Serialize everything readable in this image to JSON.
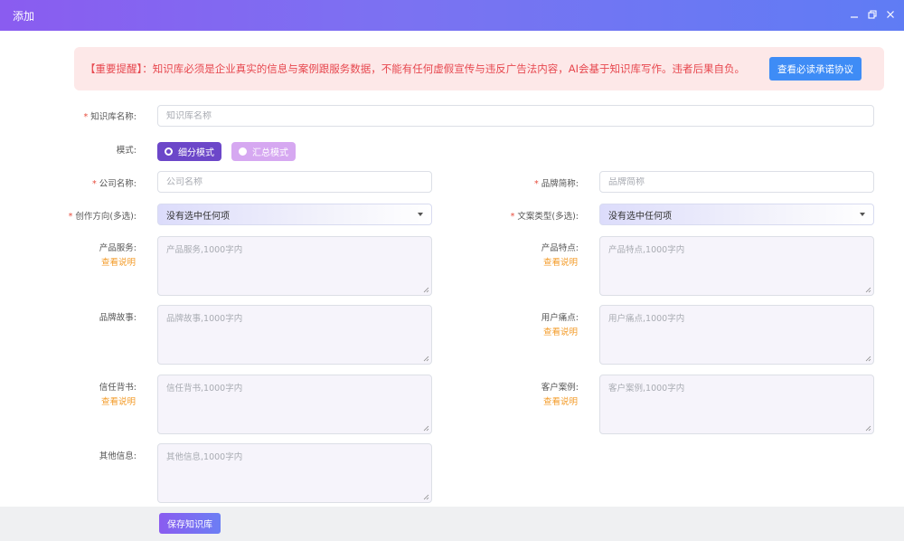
{
  "window": {
    "title": "添加",
    "controls": [
      "minimize-icon",
      "restore-icon",
      "close-icon"
    ]
  },
  "notice": {
    "text": "【重要提醒】：知识库必须是企业真实的信息与案例跟服务数据，不能有任何虚假宣传与违反广告法内容，AI会基于知识库写作。违者后果自负。",
    "button": "查看必读承诺协议"
  },
  "form": {
    "kb_name": {
      "label": "知识库名称:",
      "placeholder": "知识库名称",
      "required": true
    },
    "mode": {
      "label": "模式:",
      "options": [
        "细分模式",
        "汇总模式"
      ],
      "selected": "细分模式"
    },
    "company": {
      "label": "公司名称:",
      "placeholder": "公司名称",
      "required": true
    },
    "brand": {
      "label": "品牌简称:",
      "placeholder": "品牌简称",
      "required": true
    },
    "direction": {
      "label": "创作方向(多选):",
      "value": "没有选中任何项",
      "required": true
    },
    "copy_type": {
      "label": "文案类型(多选):",
      "value": "没有选中任何项",
      "required": true
    },
    "product_service": {
      "label": "产品服务:",
      "placeholder": "产品服务,1000字内",
      "help": "查看说明"
    },
    "product_feature": {
      "label": "产品特点:",
      "placeholder": "产品特点,1000字内",
      "help": "查看说明"
    },
    "brand_story": {
      "label": "品牌故事:",
      "placeholder": "品牌故事,1000字内"
    },
    "user_pain": {
      "label": "用户痛点:",
      "placeholder": "用户痛点,1000字内",
      "help": "查看说明"
    },
    "trust": {
      "label": "信任背书:",
      "placeholder": "信任背书,1000字内",
      "help": "查看说明"
    },
    "case": {
      "label": "客户案例:",
      "placeholder": "客户案例,1000字内",
      "help": "查看说明"
    },
    "other": {
      "label": "其他信息:",
      "placeholder": "其他信息,1000字内"
    }
  },
  "footer": {
    "save": "保存知识库"
  },
  "colors": {
    "accent": "#6c47c9",
    "notice_text": "#e7484f",
    "help_link": "#f39b28",
    "primary_btn": "#3e8cf6"
  }
}
